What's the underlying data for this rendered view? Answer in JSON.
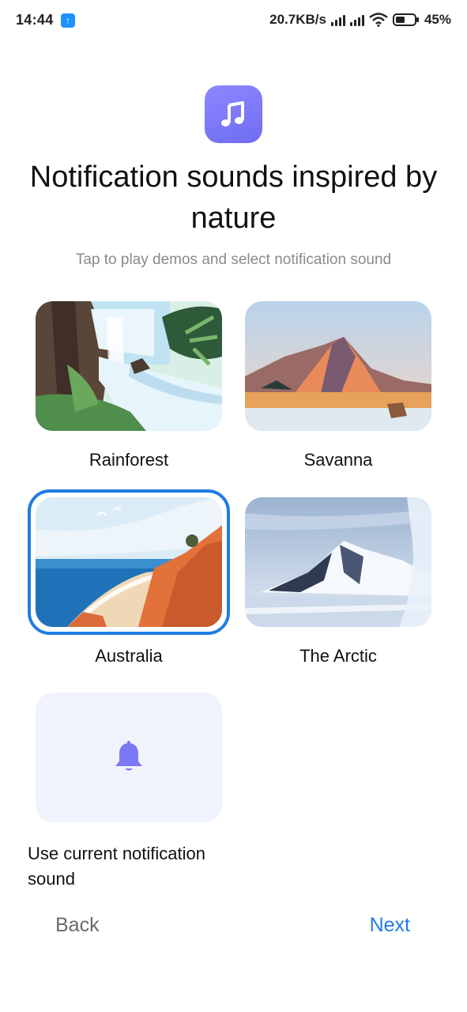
{
  "status_bar": {
    "time": "14:44",
    "network_speed": "20.7KB/s",
    "battery_percent": "45%"
  },
  "header": {
    "icon": "music-note-icon",
    "title": "Notification sounds inspired by nature",
    "subtitle": "Tap to play demos and select notification sound"
  },
  "options": [
    {
      "label": "Rainforest"
    },
    {
      "label": "Savanna"
    },
    {
      "label": "Australia",
      "selected": true
    },
    {
      "label": "The Arctic"
    }
  ],
  "current_option": {
    "icon": "bell-icon",
    "label": "Use current notification sound"
  },
  "footer": {
    "back_label": "Back",
    "next_label": "Next"
  },
  "colors": {
    "accent": "#1f7de2",
    "icon_purple": "#7b78f5"
  }
}
